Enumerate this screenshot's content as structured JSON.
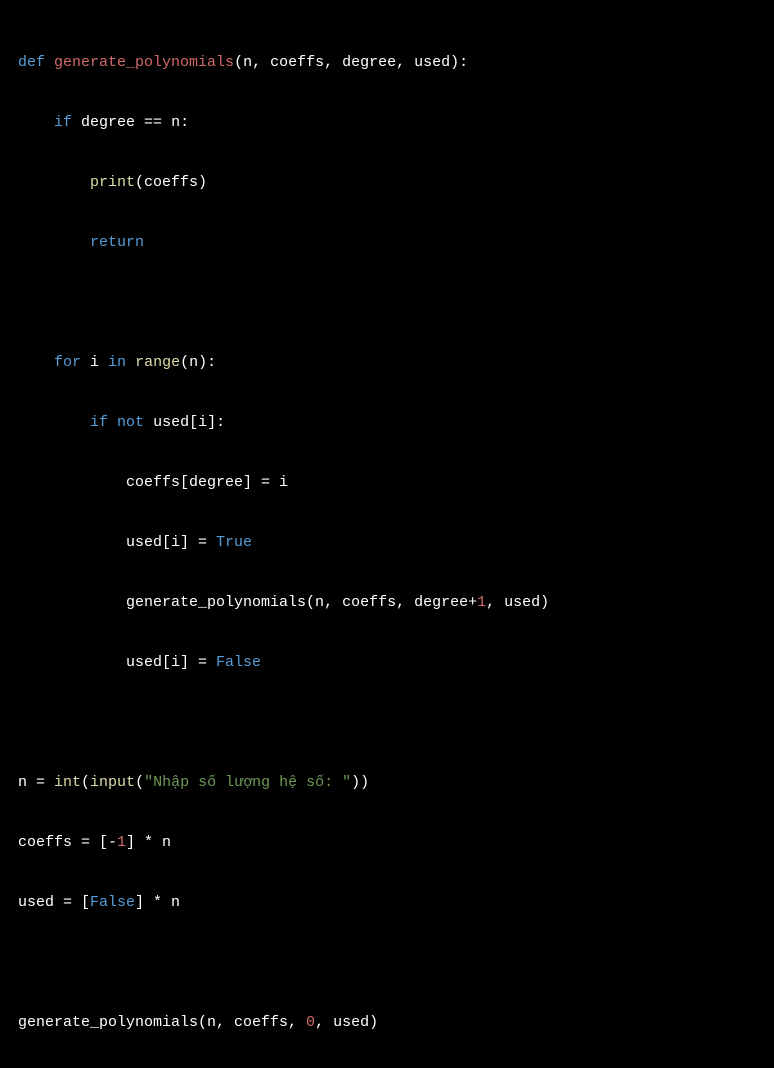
{
  "code": {
    "line1": {
      "def": "def",
      "fname": "generate_polynomials",
      "params": "(n, coeffs, degree, used):"
    },
    "line2": {
      "indent": "    ",
      "if": "if",
      "expr": " degree ",
      "op": "==",
      "expr2": " n:"
    },
    "line3": {
      "indent": "        ",
      "print": "print",
      "args": "(coeffs)"
    },
    "line4": {
      "indent": "        ",
      "return": "return"
    },
    "line5": {
      "indent": "    ",
      "for": "for",
      "var": " i ",
      "in": "in",
      "space": " ",
      "range": "range",
      "args": "(n):"
    },
    "line6": {
      "indent": "        ",
      "if": "if",
      "space": " ",
      "not": "not",
      "expr": " used[i]:"
    },
    "line7": {
      "indent": "            ",
      "expr": "coeffs[degree] = i"
    },
    "line8": {
      "indent": "            ",
      "lhs": "used[i] = ",
      "val": "True"
    },
    "line9": {
      "indent": "            ",
      "call": "generate_polynomials(n, coeffs, degree+",
      "one": "1",
      "rest": ", used)"
    },
    "line10": {
      "indent": "            ",
      "lhs": "used[i] = ",
      "val": "False"
    },
    "line11": {
      "lhs": "n = ",
      "int": "int",
      "p1": "(",
      "input": "input",
      "p2": "(",
      "str": "\"Nhập số lượng hệ số: \"",
      "p3": "))"
    },
    "line12": {
      "lhs": "coeffs = [-",
      "one": "1",
      "rest": "] * n"
    },
    "line13": {
      "lhs": "used = [",
      "val": "False",
      "rest": "] * n"
    },
    "line14": {
      "call": "generate_polynomials(n, coeffs, ",
      "zero": "0",
      "rest": ", used)"
    }
  }
}
